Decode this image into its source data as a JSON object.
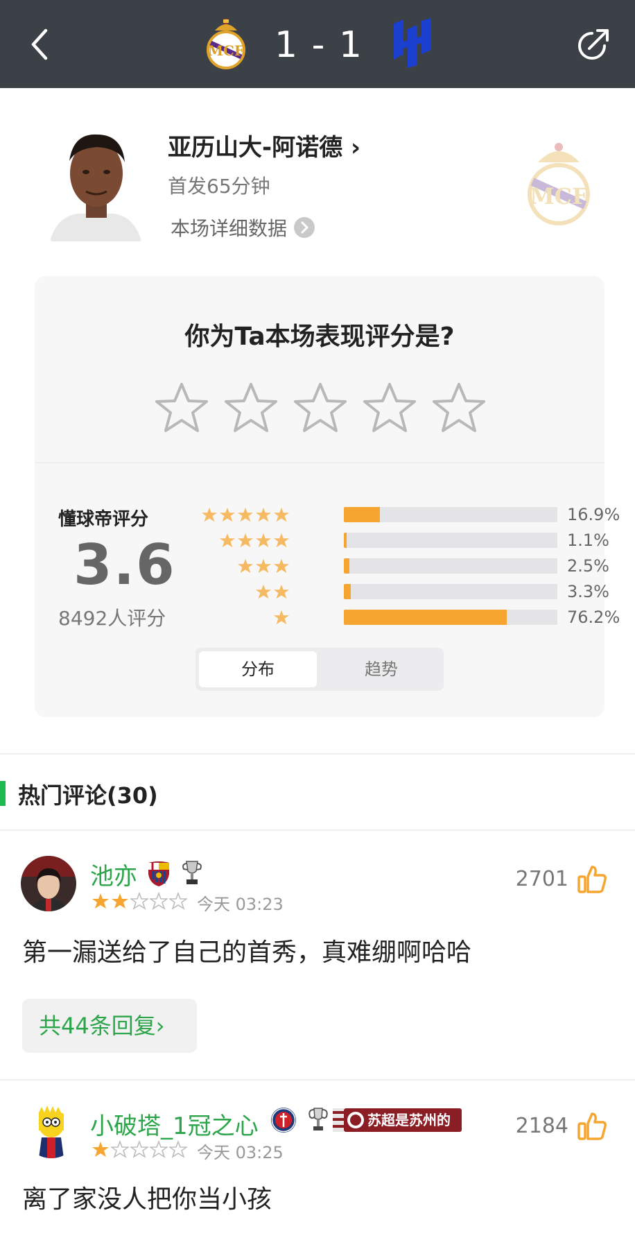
{
  "header": {
    "score": "1 - 1",
    "home_crest_icon": "real-madrid-crest-icon",
    "away_crest_icon": "al-hilal-crest-icon"
  },
  "player": {
    "name": "亚历山大-阿诺德",
    "name_chevron": "›",
    "meta": "首发65分钟",
    "detail_link": "本场详细数据"
  },
  "rating": {
    "question": "你为Ta本场表现评分是?",
    "score_label": "懂球帝评分",
    "score_value": "3.6",
    "rater_count": "8492人评分",
    "distribution": [
      {
        "stars": 5,
        "percent": 16.9,
        "label": "16.9%"
      },
      {
        "stars": 4,
        "percent": 1.1,
        "label": "1.1%"
      },
      {
        "stars": 3,
        "percent": 2.5,
        "label": "2.5%"
      },
      {
        "stars": 2,
        "percent": 3.3,
        "label": "3.3%"
      },
      {
        "stars": 1,
        "percent": 76.2,
        "label": "76.2%"
      }
    ],
    "tabs": [
      "分布",
      "趋势"
    ],
    "active_tab": "分布",
    "colors": {
      "bar_fill": "#f5a530",
      "bar_track": "#e4e4e6",
      "star": "#f5a530"
    }
  },
  "comments_section": {
    "title": "热门评论(30)",
    "accent": "#1eb84f"
  },
  "comments": [
    {
      "user": "池亦",
      "rating": 2,
      "time": "今天 03:23",
      "likes": "2701",
      "text": "第一漏送给了自己的首秀，真难绷啊哈哈",
      "replies": "共44条回复",
      "reply_chevron": "›"
    },
    {
      "user": "小破塔_1冠之心",
      "rating": 1,
      "time": "今天 03:25",
      "likes": "2184",
      "text": "离了家没人把你当小孩",
      "badge_text": "苏超是苏州的苏"
    }
  ]
}
